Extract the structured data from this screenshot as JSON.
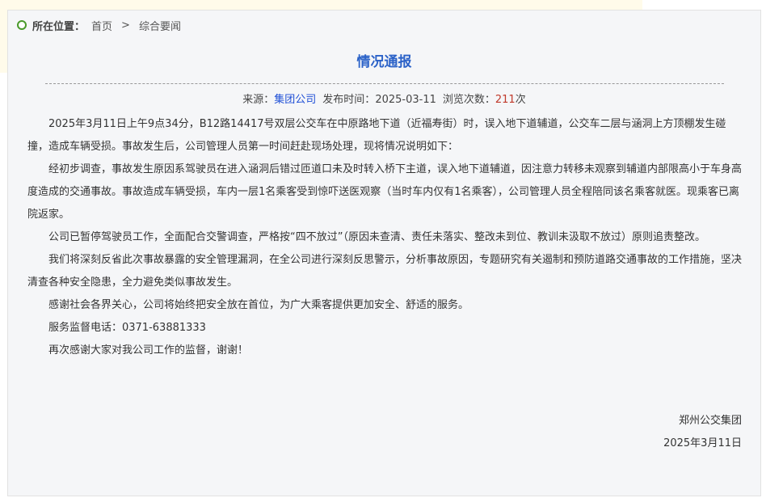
{
  "breadcrumb": {
    "label": "所在位置：",
    "items": [
      "首页",
      "综合要闻"
    ],
    "separator": ">"
  },
  "article": {
    "title": "情况通报",
    "meta": {
      "source_label": "来源：",
      "source": "集团公司",
      "date_label": "发布时间：",
      "date": "2025-03-11",
      "views_label": "浏览次数：",
      "views": "211",
      "views_unit": "次"
    },
    "paragraphs": [
      "2025年3月11日上午9点34分，B12路14417号双层公交车在中原路地下道（近福寿街）时，误入地下道辅道，公交车二层与涵洞上方顶棚发生碰撞，造成车辆受损。事故发生后，公司管理人员第一时间赶赴现场处理，现将情况说明如下：",
      "经初步调查，事故发生原因系驾驶员在进入涵洞后错过匝道口未及时转入桥下主道，误入地下道辅道，因注意力转移未观察到辅道内部限高小于车身高度造成的交通事故。事故造成车辆受损，车内一层1名乘客受到惊吓送医观察（当时车内仅有1名乘客），公司管理人员全程陪同该名乘客就医。现乘客已离院返家。",
      "公司已暂停驾驶员工作，全面配合交警调查，严格按“四不放过”（原因未查清、责任未落实、整改未到位、教训未汲取不放过）原则追责整改。",
      "我们将深刻反省此次事故暴露的安全管理漏洞，在全公司进行深刻反思警示，分析事故原因，专题研究有关遏制和预防道路交通事故的工作措施，坚决清查各种安全隐患，全力避免类似事故发生。",
      "感谢社会各界关心，公司将始终把安全放在首位，为广大乘客提供更加安全、舒适的服务。",
      "服务监督电话：0371-63881333",
      "再次感谢大家对我公司工作的监督，谢谢！"
    ],
    "signature": {
      "org": "郑州公交集团",
      "date": "2025年3月11日"
    }
  },
  "colors": {
    "title": "#2b62c8",
    "link": "#1f4fd6",
    "views": "#c0392b",
    "location_icon": "#4a9a2b"
  }
}
